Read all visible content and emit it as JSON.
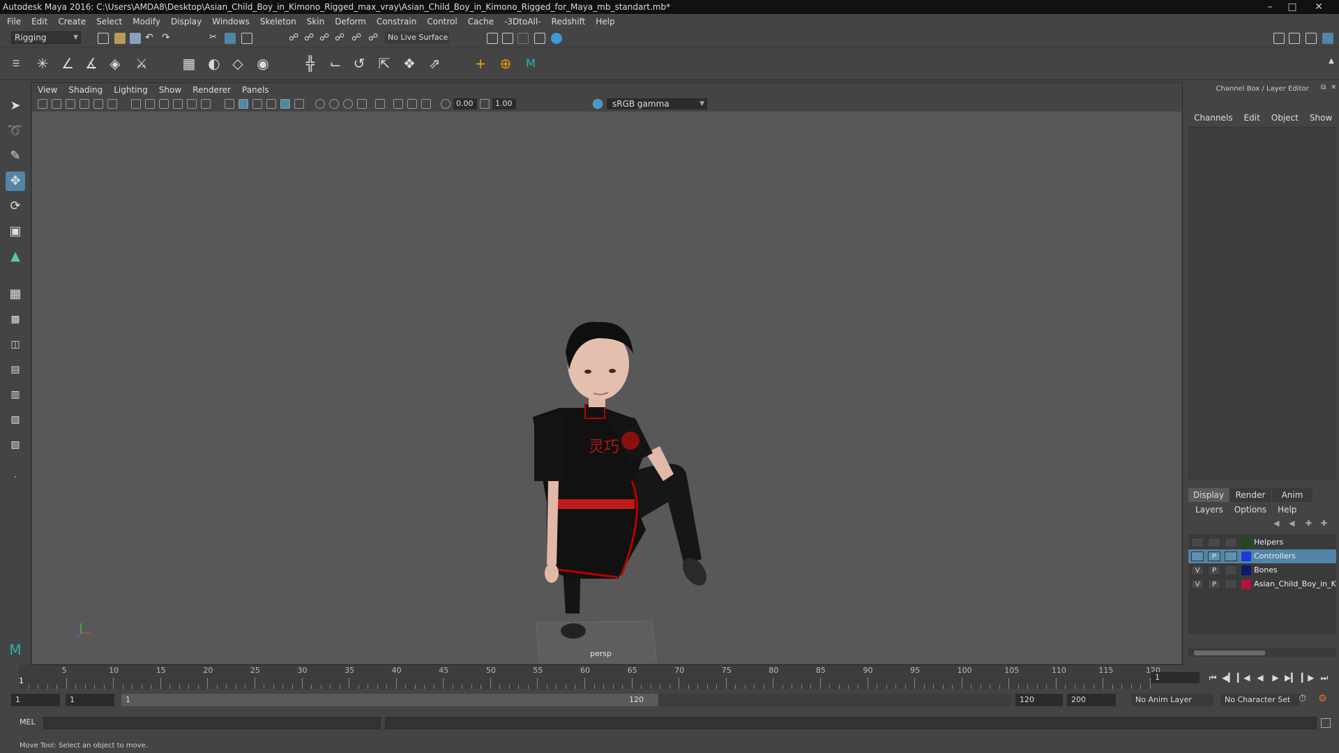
{
  "window": {
    "title": "Autodesk Maya 2016: C:\\Users\\AMDA8\\Desktop\\Asian_Child_Boy_in_Kimono_Rigged_max_vray\\Asian_Child_Boy_in_Kimono_Rigged_for_Maya_mb_standart.mb*",
    "controls": [
      "minimize-icon",
      "maximize-icon",
      "close-icon"
    ]
  },
  "menubar": [
    "File",
    "Edit",
    "Create",
    "Select",
    "Modify",
    "Display",
    "Windows",
    "Skeleton",
    "Skin",
    "Deform",
    "Constrain",
    "Control",
    "Cache",
    "-3DtoAll-",
    "Redshift",
    "Help"
  ],
  "statusline": {
    "mode": "Rigging",
    "live_surface": "No Live Surface"
  },
  "viewport": {
    "menu": [
      "View",
      "Shading",
      "Lighting",
      "Show",
      "Renderer",
      "Panels"
    ],
    "exposure": "0.00",
    "gamma_value": "1.00",
    "color_space": "sRGB gamma",
    "camera": "persp",
    "model_text": "灵巧"
  },
  "channelbox": {
    "title": "Channel Box / Layer Editor",
    "menu": [
      "Channels",
      "Edit",
      "Object",
      "Show"
    ],
    "layer_tabs": [
      "Display",
      "Render",
      "Anim"
    ],
    "layer_menu": [
      "Layers",
      "Options",
      "Help"
    ],
    "layers": [
      {
        "v": "",
        "p": "",
        "name": "Helpers",
        "color": "#1e4a1e",
        "selected": false
      },
      {
        "v": "",
        "p": "P",
        "name": "Controllers",
        "color": "#1a3ad8",
        "selected": true
      },
      {
        "v": "V",
        "p": "P",
        "name": "Bones",
        "color": "#0b1a6a",
        "selected": false
      },
      {
        "v": "V",
        "p": "P",
        "name": "Asian_Child_Boy_in_Ki",
        "color": "#b0143c",
        "selected": false
      }
    ]
  },
  "timeline": {
    "ticks": [
      "5",
      "10",
      "15",
      "20",
      "25",
      "30",
      "35",
      "40",
      "45",
      "50",
      "55",
      "60",
      "65",
      "70",
      "75",
      "80",
      "85",
      "90",
      "95",
      "100",
      "105",
      "110",
      "115",
      "120"
    ],
    "current_frame": "1",
    "current_frame_field": "1"
  },
  "range": {
    "start": "1",
    "start_inner": "1",
    "bar_start": "1",
    "bar_end": "120",
    "end_inner": "120",
    "end": "200",
    "anim_layer": "No Anim Layer",
    "character_set": "No Character Set"
  },
  "cmdline": {
    "label": "MEL"
  },
  "helpline": "Move Tool: Select an object to move."
}
